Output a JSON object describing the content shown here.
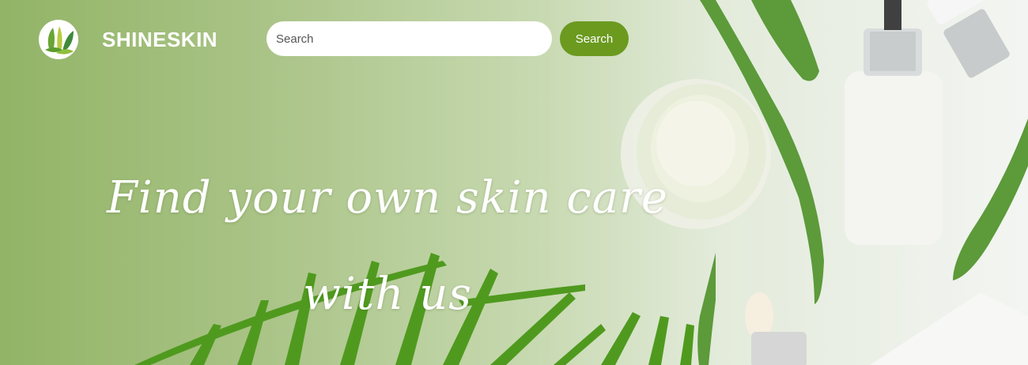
{
  "header": {
    "logo_icon": "leaf-logo-icon",
    "brand": "SHINESKIN"
  },
  "search": {
    "placeholder": "Search",
    "value": "",
    "button_label": "Search"
  },
  "hero": {
    "headline": "Find your own skin care with us"
  },
  "colors": {
    "accent": "#6b9a1f",
    "hero_green": "#92b466",
    "text_on_hero": "#ffffff"
  }
}
